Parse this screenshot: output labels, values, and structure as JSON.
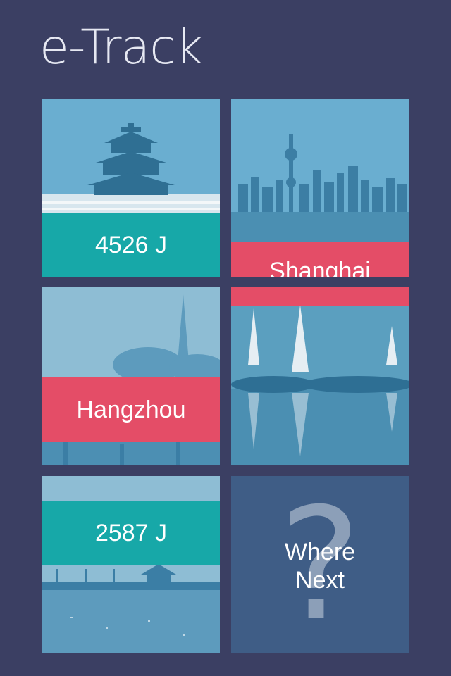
{
  "app": {
    "title": "e-Track"
  },
  "tiles": [
    {
      "id": "beijing",
      "band_text": "4526 J",
      "band_color": "#17a8a8"
    },
    {
      "id": "shanghai",
      "band_text": "Shanghai",
      "band_color": "#e44d67"
    },
    {
      "id": "hangzhou",
      "band_text": "Hangzhou",
      "band_color": "#e44d67"
    },
    {
      "id": "dali",
      "band_text": "",
      "band_color": "#e44d67"
    },
    {
      "id": "lakeside",
      "band_text": "2587 J",
      "band_color": "#17a8a8"
    },
    {
      "id": "where-next",
      "line1": "Where",
      "line2": "Next",
      "icon": "question-mark-icon"
    }
  ],
  "colors": {
    "background": "#3b3f63",
    "teal": "#17a8a8",
    "red": "#e44d67",
    "photo_tint": "#5b9fbf"
  }
}
